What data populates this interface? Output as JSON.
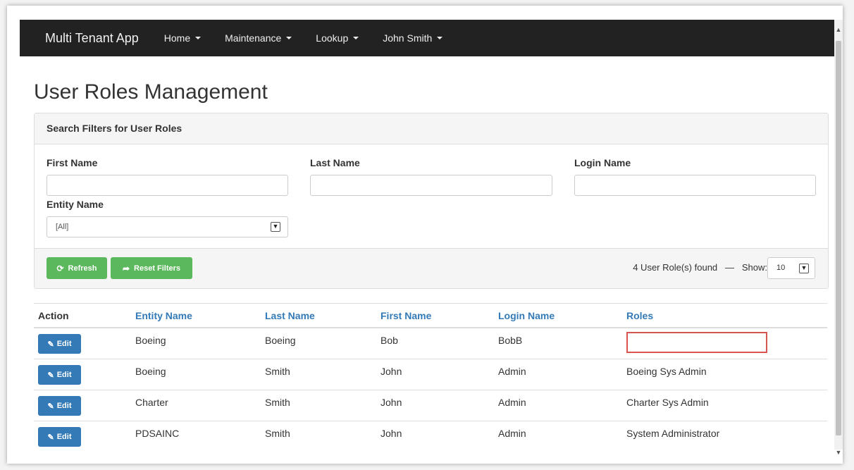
{
  "navbar": {
    "brand": "Multi Tenant App",
    "items": [
      {
        "label": "Home"
      },
      {
        "label": "Maintenance"
      },
      {
        "label": "Lookup"
      },
      {
        "label": "John Smith"
      }
    ]
  },
  "page": {
    "title": "User Roles Management"
  },
  "filters": {
    "heading": "Search Filters for User Roles",
    "first_name_label": "First Name",
    "last_name_label": "Last Name",
    "login_name_label": "Login Name",
    "entity_name_label": "Entity Name",
    "entity_selected": "[All]",
    "refresh_label": "Refresh",
    "reset_label": "Reset Filters",
    "found_text": "4 User Role(s) found",
    "dash": "—",
    "show_label": "Show:",
    "show_value": "10"
  },
  "table": {
    "headers": {
      "action": "Action",
      "entity": "Entity Name",
      "last": "Last Name",
      "first": "First Name",
      "login": "Login Name",
      "roles": "Roles"
    },
    "edit_label": "Edit",
    "rows": [
      {
        "entity": "Boeing",
        "last": "Boeing",
        "first": "Bob",
        "login": "BobB",
        "roles": ""
      },
      {
        "entity": "Boeing",
        "last": "Smith",
        "first": "John",
        "login": "Admin",
        "roles": "Boeing Sys Admin"
      },
      {
        "entity": "Charter",
        "last": "Smith",
        "first": "John",
        "login": "Admin",
        "roles": "Charter Sys Admin"
      },
      {
        "entity": "PDSAINC",
        "last": "Smith",
        "first": "John",
        "login": "Admin",
        "roles": "System Administrator"
      }
    ]
  },
  "colors": {
    "navbar": "#222222",
    "success": "#5cb85c",
    "primary": "#337ab7",
    "highlight": "#d9534f"
  },
  "icons": {
    "refresh": "refresh-icon",
    "reset": "share-arrow-icon",
    "edit": "edit-icon",
    "dropdown": "chevron-down-icon"
  }
}
